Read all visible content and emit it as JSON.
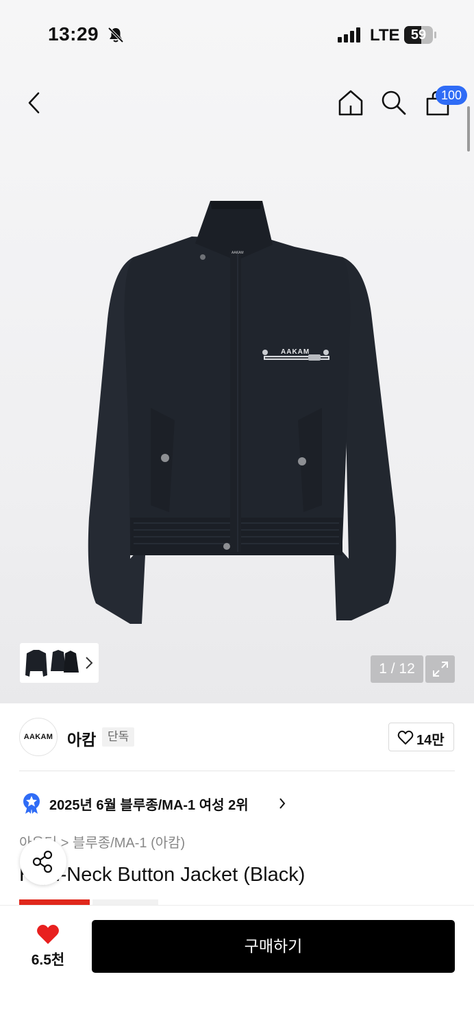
{
  "status_bar": {
    "time": "13:29",
    "network": "LTE",
    "battery": "59",
    "battery_level": 0.59
  },
  "header": {
    "cart_count": "100"
  },
  "gallery": {
    "pager": "1 / 12",
    "garment_logo": "AAKAM",
    "collar_label": "AAKAM"
  },
  "brand": {
    "logo_text": "AAKAM",
    "name": "아캄",
    "tag": "단독",
    "like_count": "14만"
  },
  "ranking": {
    "text": "2025년 6월 블루종/MA-1 여성 2위"
  },
  "breadcrumb": {
    "text": "아우터 > 블루종/MA-1 (아캄)"
  },
  "product": {
    "title": "High-Neck Button Jacket (Black)"
  },
  "bottom_bar": {
    "wish_count": "6.5천",
    "buy_label": "구매하기"
  },
  "colors": {
    "accent": "#2f6cf6",
    "heart": "#e8201f",
    "rank_badge": "#2f6cf6",
    "buy_button": "#000000"
  },
  "icons": [
    "bell-off-icon",
    "signal-icon",
    "back-icon",
    "home-icon",
    "search-icon",
    "cart-icon",
    "chevron-right-icon",
    "expand-icon",
    "heart-outline-icon",
    "rank-badge-icon",
    "share-icon",
    "heart-filled-icon"
  ]
}
